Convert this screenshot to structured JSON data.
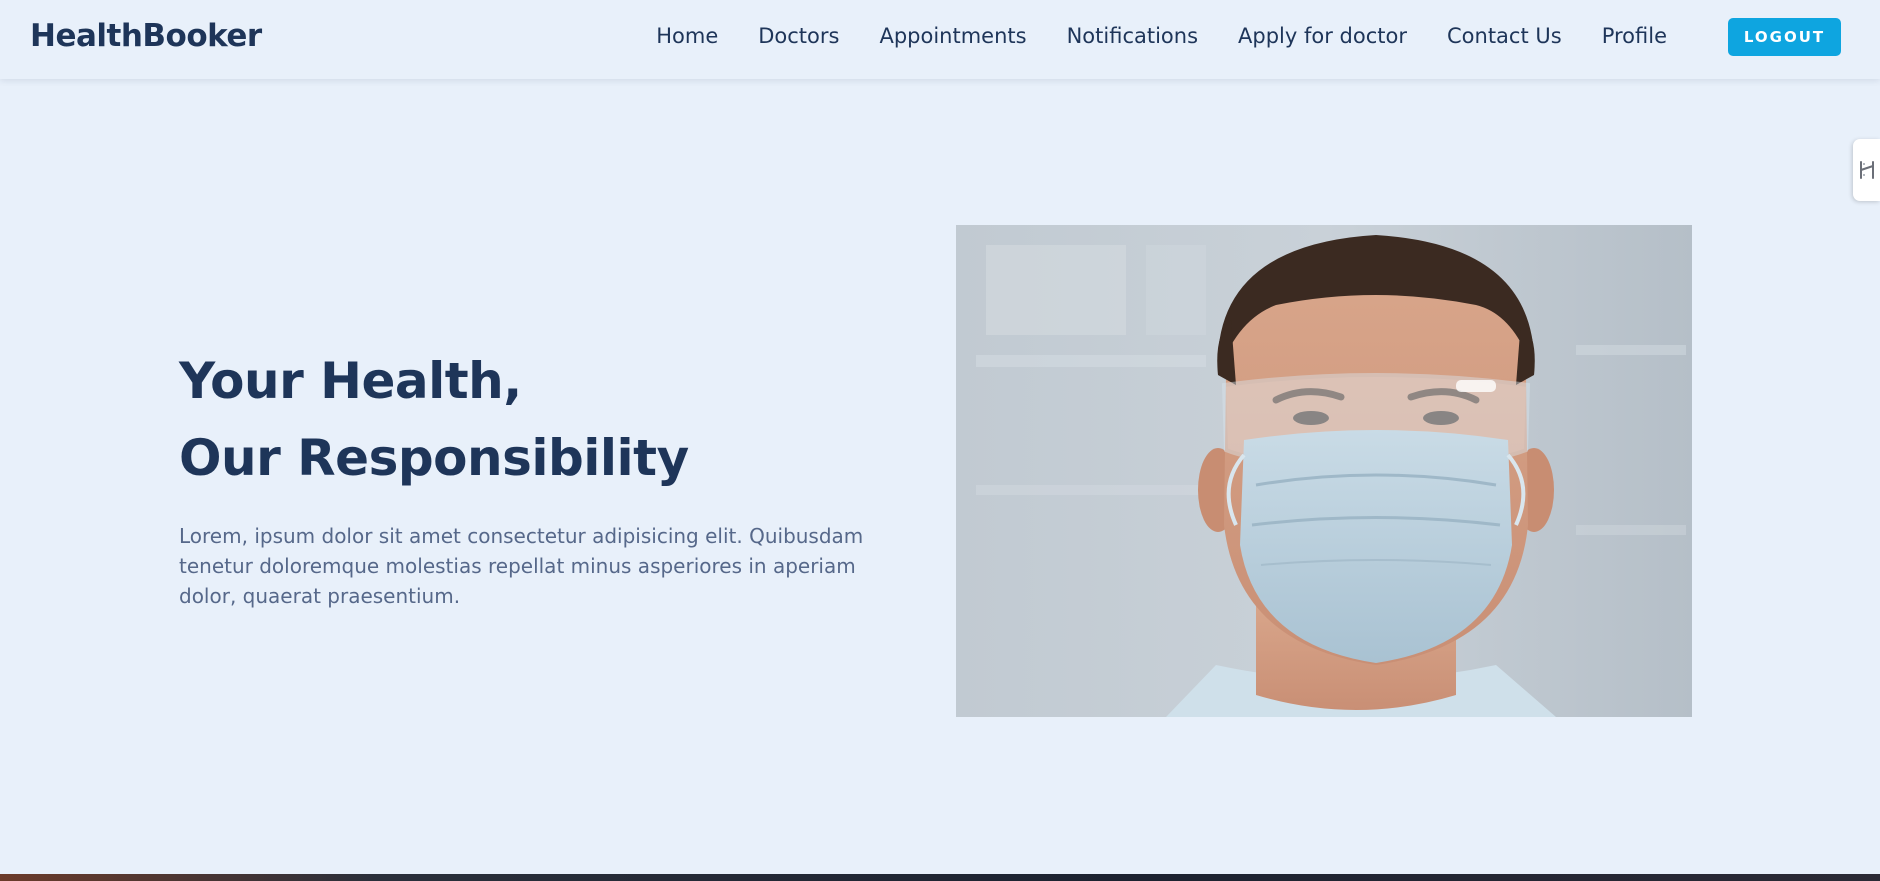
{
  "navbar": {
    "brand": "HealthBooker",
    "links": [
      "Home",
      "Doctors",
      "Appointments",
      "Notifications",
      "Apply for doctor",
      "Contact Us",
      "Profile"
    ],
    "logout_label": "LOGOUT"
  },
  "hero": {
    "title_line1": "Your Health,",
    "title_line2": "Our Responsibility",
    "text": "Lorem, ipsum dolor sit amet consectetur adipisicing elit. Quibusdam tenetur doloremque molestias repellat minus asperiores in aperiam dolor, quaerat praesentium."
  },
  "colors": {
    "background": "#e8f0fa",
    "primary_text": "#1e3559",
    "body_text": "#56688a",
    "accent": "#0ea5e0"
  },
  "icons": {
    "side_tab": "extension-handle-icon",
    "hero_image": "doctor-face-mask-illustration"
  }
}
